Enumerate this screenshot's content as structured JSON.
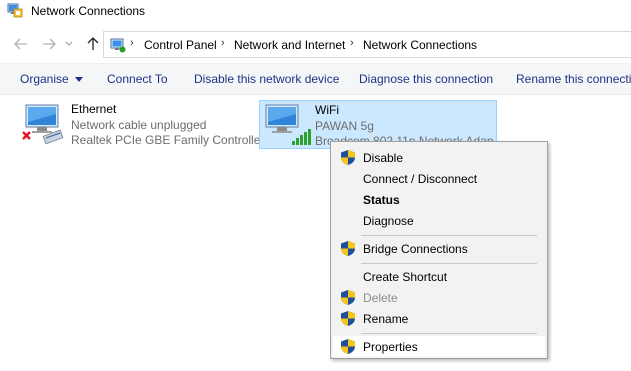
{
  "window": {
    "title": "Network Connections"
  },
  "address_bar": {
    "breadcrumbs": [
      "Control Panel",
      "Network and Internet",
      "Network Connections"
    ]
  },
  "command_bar": {
    "organise": "Organise",
    "connect_to": "Connect To",
    "disable_device": "Disable this network device",
    "diagnose": "Diagnose this connection",
    "rename": "Rename this connectio"
  },
  "connections": [
    {
      "name": "Ethernet",
      "status": "Network cable unplugged",
      "device": "Realtek PCIe GBE Family Controller",
      "selected": false
    },
    {
      "name": "WiFi",
      "status": "PAWAN 5g",
      "device": "Broadcom 802.11n Network Adap",
      "selected": true
    }
  ],
  "context_menu": {
    "items": [
      {
        "label": "Disable",
        "shield": true,
        "bold": false,
        "disabled": false
      },
      {
        "label": "Connect / Disconnect",
        "shield": false,
        "bold": false,
        "disabled": false
      },
      {
        "label": "Status",
        "shield": false,
        "bold": true,
        "disabled": false
      },
      {
        "label": "Diagnose",
        "shield": false,
        "bold": false,
        "disabled": false
      },
      {
        "label": "Bridge Connections",
        "shield": true,
        "bold": false,
        "disabled": false
      },
      {
        "label": "Create Shortcut",
        "shield": false,
        "bold": false,
        "disabled": false
      },
      {
        "label": "Delete",
        "shield": true,
        "bold": false,
        "disabled": true
      },
      {
        "label": "Rename",
        "shield": true,
        "bold": false,
        "disabled": false
      },
      {
        "label": "Properties",
        "shield": true,
        "bold": false,
        "disabled": false,
        "highlighted": true
      }
    ]
  },
  "colors": {
    "command_text": "#1e3287",
    "selection_bg": "#cce8ff",
    "selection_border": "#99d1ff",
    "menu_bg": "#f2f2f2",
    "error_red": "#e81123",
    "signal_green": "#2ea02e"
  },
  "icons": {
    "title": "network-connections-icon",
    "back": "arrow-left-icon",
    "forward": "arrow-right-icon",
    "up": "arrow-up-icon",
    "ethernet": "ethernet-adapter-icon",
    "wifi": "wifi-adapter-icon",
    "uac": "uac-shield-icon",
    "organise_dropdown": "caret-down-icon"
  }
}
